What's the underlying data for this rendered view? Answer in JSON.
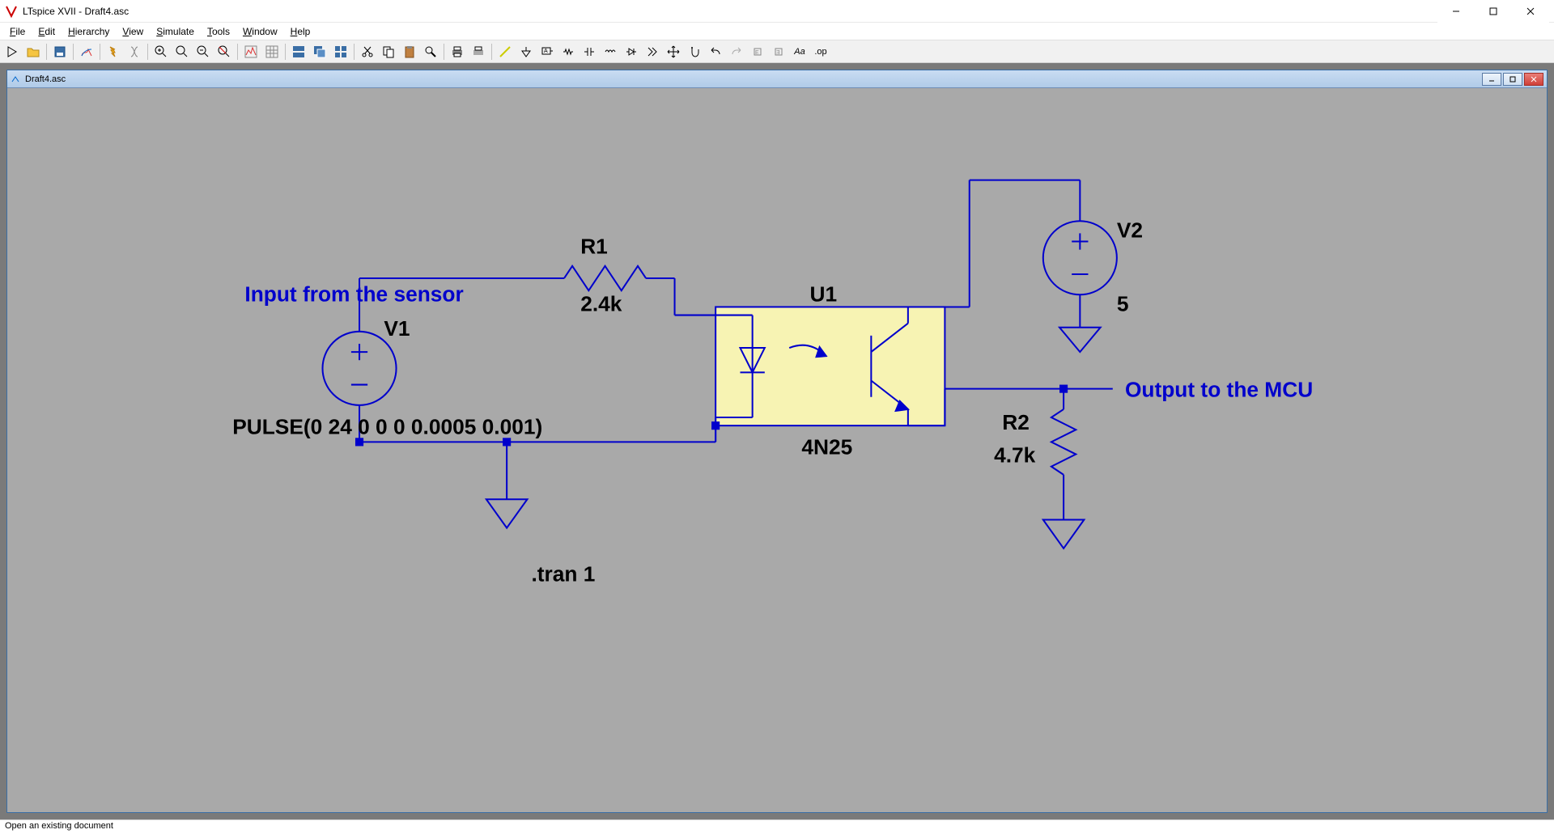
{
  "app": {
    "title": "LTspice XVII - Draft4.asc",
    "child_title": "Draft4.asc",
    "status": "Open an existing document"
  },
  "menu": {
    "file": "File",
    "edit": "Edit",
    "hierarchy": "Hierarchy",
    "view": "View",
    "simulate": "Simulate",
    "tools": "Tools",
    "window": "Window",
    "help": "Help"
  },
  "toolbar": {
    "text_label": "Aa",
    "op_label": ".op"
  },
  "schematic": {
    "labels": {
      "input_note": "Input from the sensor",
      "output_note": "Output to the MCU",
      "v1_name": "V1",
      "v1_value": "PULSE(0 24 0 0 0 0.0005 0.001)",
      "v2_name": "V2",
      "v2_value": "5",
      "r1_name": "R1",
      "r1_value": "2.4k",
      "r2_name": "R2",
      "r2_value": "4.7k",
      "u1_name": "U1",
      "u1_value": "4N25",
      "directive": ".tran 1"
    }
  }
}
